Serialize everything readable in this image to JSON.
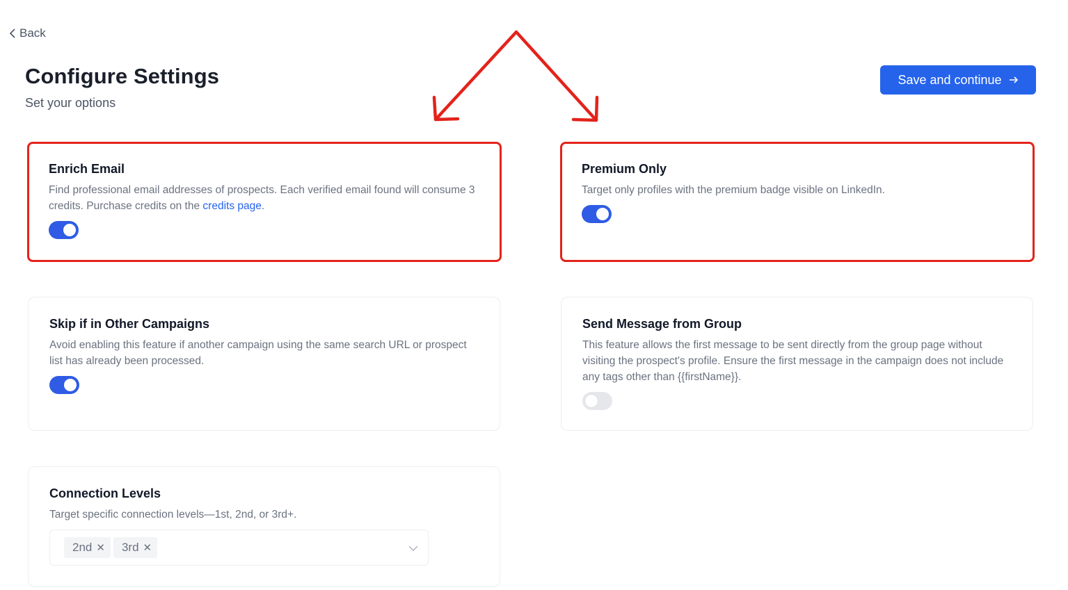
{
  "header": {
    "back_label": "Back",
    "title": "Configure Settings",
    "subtitle": "Set your options",
    "save_label": "Save and continue"
  },
  "cards": {
    "enrich_email": {
      "title": "Enrich Email",
      "desc": "Find professional email addresses of prospects. Each verified email found will consume 3 credits. Purchase credits on the ",
      "link": "credits page",
      "desc_end": ".",
      "enabled": true
    },
    "premium_only": {
      "title": "Premium Only",
      "desc": "Target only profiles with the premium badge visible on LinkedIn.",
      "enabled": true
    },
    "skip_campaigns": {
      "title": "Skip if in Other Campaigns",
      "desc": "Avoid enabling this feature if another campaign using the same search URL or prospect list has already been processed.",
      "enabled": true
    },
    "send_group": {
      "title": "Send Message from Group",
      "desc": "This feature allows the first message to be sent directly from the group page without visiting the prospect's profile. Ensure the first message in the campaign does not include any tags other than {{firstName}}.",
      "enabled": false
    },
    "connection_levels": {
      "title": "Connection Levels",
      "desc": "Target specific connection levels—1st, 2nd, or 3rd+.",
      "tags": [
        "2nd",
        "3rd"
      ]
    }
  },
  "colors": {
    "accent": "#2563eb",
    "highlight": "#e3231b",
    "annotation_arrow": "#e3231b"
  }
}
